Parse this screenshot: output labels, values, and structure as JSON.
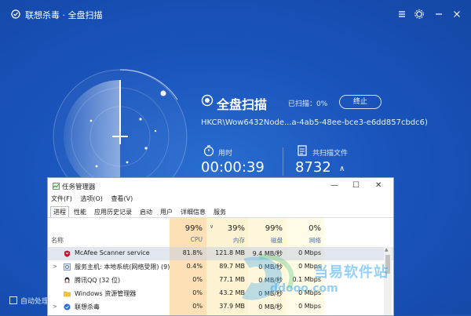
{
  "app": {
    "title": "联想杀毒 · 全盘扫描",
    "scan_title": "全盘扫描",
    "progress_label": "已扫描：0%",
    "stop_button": "终止",
    "scan_path": "HKCR\\Wow6432Node...a-4ab5-48ee-bce3-e6dd857cbdc6)",
    "time_label": "用时",
    "time_value": "00:00:39",
    "files_label": "共扫描文件",
    "files_value": "8732",
    "files_arrow": "∧",
    "auto_process_label": "自动处理",
    "colors": {
      "bg": "#1a55bd",
      "text": "#ffffff"
    }
  },
  "taskmgr": {
    "title": "任务管理器",
    "menus": [
      "文件(F)",
      "选项(O)",
      "查看(V)"
    ],
    "tabs": [
      "进程",
      "性能",
      "应用历史记录",
      "启动",
      "用户",
      "详细信息",
      "服务"
    ],
    "name_header": "名称",
    "columns": [
      {
        "pct": "99%",
        "label": "CPU"
      },
      {
        "pct": "39%",
        "label": "内存"
      },
      {
        "pct": "99%",
        "label": "磁盘"
      },
      {
        "pct": "0%",
        "label": "网络"
      }
    ],
    "rows": [
      {
        "name": "McAfee Scanner service",
        "cpu": "81.8%",
        "mem": "121.8 MB",
        "disk": "9.4 MB/秒",
        "net": "0 Mbps",
        "expander": "",
        "icon": "mcafee-icon"
      },
      {
        "name": "服务主机: 本地系统(网络受限) (9)",
        "cpu": "0.4%",
        "mem": "89.7 MB",
        "disk": "0 MB/秒",
        "net": "0 Mbps",
        "expander": ">",
        "icon": "service-host-icon"
      },
      {
        "name": "腾讯QQ (32 位)",
        "cpu": "0%",
        "mem": "77.1 MB",
        "disk": "0 MB/秒",
        "net": "0.1 Mbps",
        "expander": "",
        "icon": "qq-icon"
      },
      {
        "name": "Windows 资源管理器",
        "cpu": "0%",
        "mem": "43.2 MB",
        "disk": "0 MB/秒",
        "net": "0 Mbps",
        "expander": "",
        "icon": "explorer-icon"
      },
      {
        "name": "联想杀毒",
        "cpu": "0%",
        "mem": "37.9 MB",
        "disk": "0 MB/秒",
        "net": "0 Mbps",
        "expander": ">",
        "icon": "lenovo-av-icon"
      }
    ]
  },
  "watermark": {
    "text": "当易软件站",
    "url": "ddooo.com"
  }
}
